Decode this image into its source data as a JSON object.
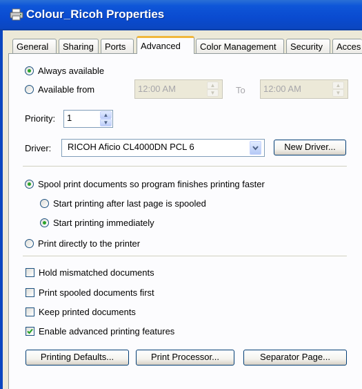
{
  "window": {
    "title": "Colour_Ricoh Properties",
    "icon": "printer-icon"
  },
  "tabs": [
    {
      "label": "General"
    },
    {
      "label": "Sharing"
    },
    {
      "label": "Ports"
    },
    {
      "label": "Advanced",
      "active": true
    },
    {
      "label": "Color Management"
    },
    {
      "label": "Security"
    },
    {
      "label": "Acces"
    }
  ],
  "availability": {
    "always_label": "Always available",
    "from_label": "Available from",
    "selected": "always",
    "from_time": "12:00 AM",
    "to_label": "To",
    "to_time": "12:00 AM"
  },
  "priority": {
    "label": "Priority:",
    "value": "1"
  },
  "driver": {
    "label": "Driver:",
    "value": "RICOH Aficio CL4000DN PCL 6",
    "new_driver_button": "New Driver..."
  },
  "spooling": {
    "spool_label": "Spool print documents so program finishes printing faster",
    "after_last_label": "Start printing after last page is spooled",
    "immediately_label": "Start printing immediately",
    "direct_label": "Print directly to the printer",
    "selected_mode": "spool",
    "selected_start": "immediately"
  },
  "options": [
    {
      "label": "Hold mismatched documents",
      "checked": false
    },
    {
      "label": "Print spooled documents first",
      "checked": false
    },
    {
      "label": "Keep printed documents",
      "checked": false
    },
    {
      "label": "Enable advanced printing features",
      "checked": true
    }
  ],
  "buttons": {
    "printing_defaults": "Printing Defaults...",
    "print_processor": "Print Processor...",
    "separator_page": "Separator Page..."
  },
  "colors": {
    "titlebar": "#0a4bd0",
    "tab_active_accent": "#f0b73b",
    "check_green": "#21a121"
  }
}
